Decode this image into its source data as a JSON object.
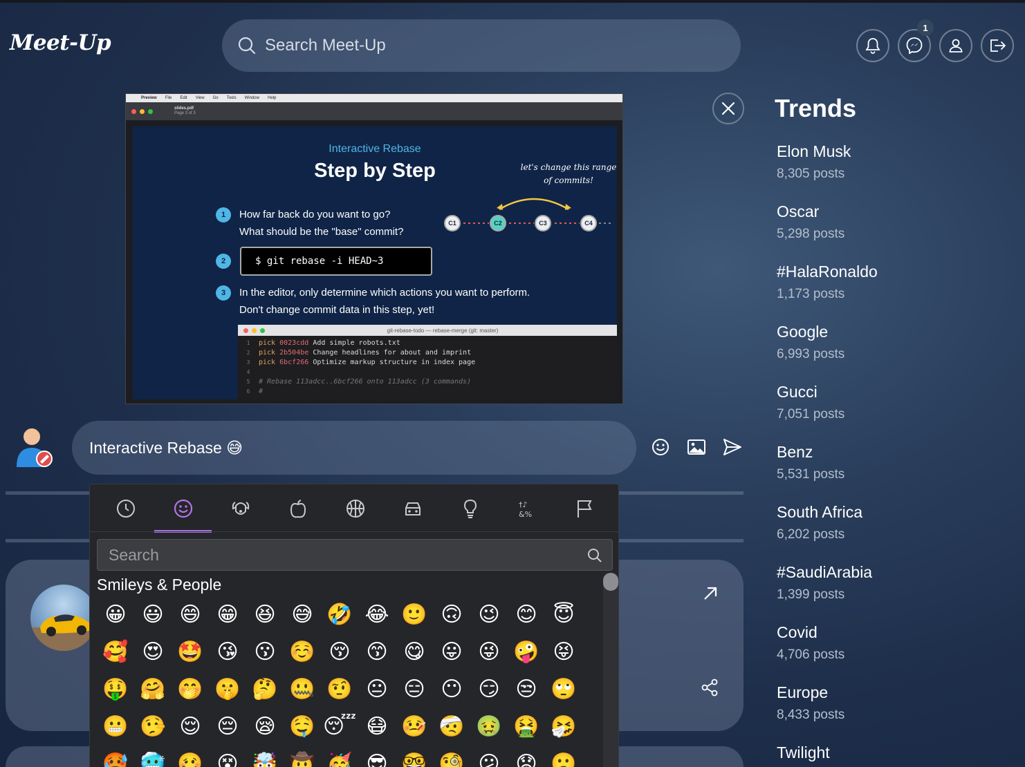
{
  "app": {
    "logo": "Meet-Up"
  },
  "search": {
    "placeholder": "Search Meet-Up"
  },
  "header": {
    "messages_badge": "1"
  },
  "preview": {
    "menubar": [
      "Preview",
      "File",
      "Edit",
      "View",
      "Go",
      "Tools",
      "Window",
      "Help"
    ],
    "file_name": "slides.pdf",
    "file_page": "Page 3 of 3",
    "slide_subtitle": "Interactive Rebase",
    "slide_title": "Step by Step",
    "slide_note": "let's change this range of commits!",
    "steps": [
      {
        "num": "1",
        "line1": "How far back do you want to go?",
        "line2": "What should be the \"base\" commit?"
      },
      {
        "num": "2",
        "code": "$ git rebase -i HEAD~3"
      },
      {
        "num": "3",
        "line1": "In the editor, only determine which actions you want to perform.",
        "line2": "Don't change commit data in this step, yet!"
      }
    ],
    "commits": [
      "C1",
      "C2",
      "C3",
      "C4"
    ],
    "editor_title": "git-rebase-todo — rebase-merge (git: master)",
    "editor_lines": [
      {
        "n": "1",
        "kw": "pick",
        "hash": "0023cdd",
        "msg": "Add simple robots.txt"
      },
      {
        "n": "2",
        "kw": "pick",
        "hash": "2b504be",
        "msg": "Change headlines for about and imprint"
      },
      {
        "n": "3",
        "kw": "pick",
        "hash": "6bcf266",
        "msg": "Optimize markup structure in index page"
      },
      {
        "n": "4",
        "kw": "",
        "hash": "",
        "msg": ""
      },
      {
        "n": "5",
        "comment": "# Rebase 113adcc..6bcf266 onto 113adcc (3 commands)"
      },
      {
        "n": "6",
        "comment": "#"
      }
    ]
  },
  "trends": {
    "title": "Trends",
    "items": [
      {
        "name": "Elon Musk",
        "count": "8,305 posts"
      },
      {
        "name": "Oscar",
        "count": "5,298 posts"
      },
      {
        "name": "#HalaRonaldo",
        "count": "1,173 posts"
      },
      {
        "name": "Google",
        "count": "6,993 posts"
      },
      {
        "name": "Gucci",
        "count": "7,051 posts"
      },
      {
        "name": "Benz",
        "count": "5,531 posts"
      },
      {
        "name": "South Africa",
        "count": "6,202 posts"
      },
      {
        "name": "#SaudiArabia",
        "count": "1,399 posts"
      },
      {
        "name": "Covid",
        "count": "4,706 posts"
      },
      {
        "name": "Europe",
        "count": "8,433 posts"
      },
      {
        "name": "Twilight",
        "count": ""
      }
    ]
  },
  "composer": {
    "text": "Interactive Rebase 😅"
  },
  "emoji_picker": {
    "search_placeholder": "Search",
    "section_title": "Smileys & People",
    "categories": [
      "recent-icon",
      "smileys-icon",
      "animals-icon",
      "food-icon",
      "activity-icon",
      "travel-icon",
      "objects-icon",
      "symbols-icon",
      "flags-icon"
    ],
    "emojis": [
      "😀",
      "😃",
      "😄",
      "😁",
      "😆",
      "😅",
      "🤣",
      "😂",
      "🙂",
      "🙃",
      "😉",
      "😊",
      "😇",
      "🥰",
      "😍",
      "🤩",
      "😘",
      "😗",
      "☺️",
      "😚",
      "😙",
      "😋",
      "😛",
      "😜",
      "🤪",
      "😝",
      "🤑",
      "🤗",
      "🤭",
      "🤫",
      "🤔",
      "🤐",
      "🤨",
      "😐",
      "😑",
      "😶",
      "😏",
      "😒",
      "🙄",
      "😬",
      "🤥",
      "😌",
      "😔",
      "😪",
      "🤤",
      "😴",
      "😷",
      "🤒",
      "🤕",
      "🤢",
      "🤮",
      "🤧",
      "🥵",
      "🥶",
      "🥴",
      "😵",
      "🤯",
      "🤠",
      "🥳",
      "😎",
      "🤓",
      "🧐",
      "😕",
      "😟",
      "🙁"
    ]
  }
}
